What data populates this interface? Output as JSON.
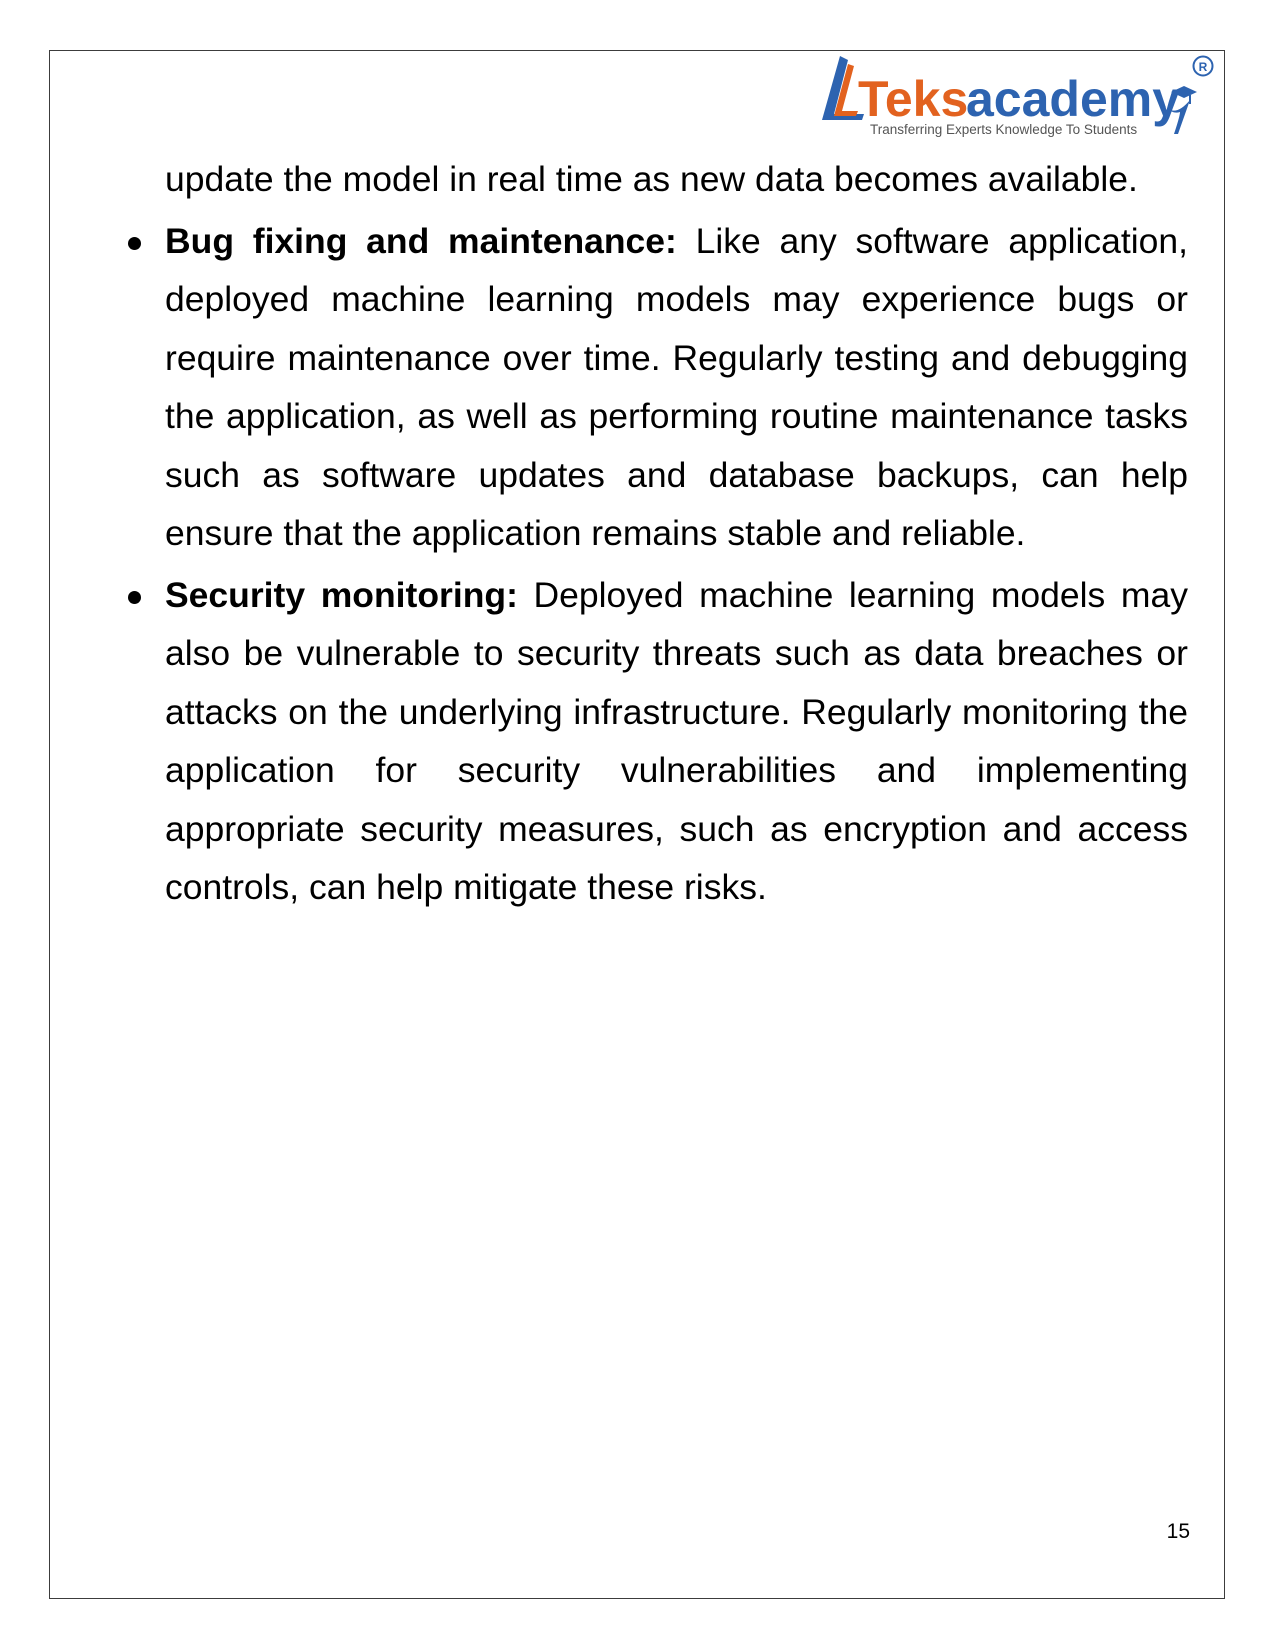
{
  "logo": {
    "brand_first": "Teks",
    "brand_second": "academy",
    "registered_mark": "®",
    "tagline": "Transferring Experts Knowledge To Students",
    "colors": {
      "orange": "#E2621F",
      "blue": "#2D63B0"
    }
  },
  "content": {
    "continuation": "update the model in real time as new data becomes available.",
    "bullets": [
      {
        "title": "Bug fixing and maintenance:",
        "text": "Like any software application, deployed machine learning models may experience bugs or require maintenance over time. Regularly testing and debugging the application, as well as performing routine maintenance tasks such as software updates and database backups, can help ensure that the application remains stable and reliable."
      },
      {
        "title": "Security monitoring:",
        "text": "Deployed machine learning models may also be vulnerable to security threats such as data breaches or attacks on the underlying infrastructure. Regularly monitoring the application for security vulnerabilities and implementing appropriate security measures, such as encryption and access controls, can help mitigate these risks."
      }
    ]
  },
  "footer": {
    "page_number": "15"
  }
}
